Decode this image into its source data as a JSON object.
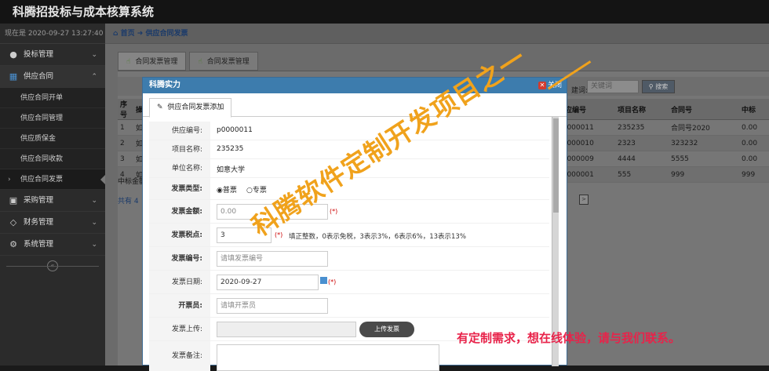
{
  "app": {
    "title": "科腾招投标与成本核算系统"
  },
  "sidebar": {
    "time_label": "现在是 2020-09-27 13:27:40",
    "groups": [
      {
        "icon": "user-icon",
        "label": "投标管理"
      },
      {
        "icon": "grid-icon",
        "label": "供应合同"
      },
      {
        "icon": "cart-icon",
        "label": "采购管理"
      },
      {
        "icon": "diamond-icon",
        "label": "财务管理"
      },
      {
        "icon": "gear-icon",
        "label": "系统管理"
      }
    ],
    "sub_items": [
      "供应合同开单",
      "供应合同管理",
      "供应质保金",
      "供应合同收款",
      "供应合同发票"
    ],
    "collapse_glyph": "«"
  },
  "breadcrumb": {
    "home": "首页",
    "current": "供应合同发票"
  },
  "tabs": [
    {
      "label": "合同发票管理"
    },
    {
      "label": "合同发票管理"
    }
  ],
  "toolbar": {
    "search_label": "建词:",
    "search_placeholder": "关键词",
    "search_button": "搜索"
  },
  "grid": {
    "columns": [
      "序号",
      "操",
      "供应编号",
      "项目名称",
      "合同号",
      "中标"
    ],
    "rows": [
      {
        "no": "1",
        "op": "如",
        "code": "p0000011",
        "project": "235235",
        "contract": "合同号2020",
        "bid": "0.00"
      },
      {
        "no": "2",
        "op": "如",
        "code": "p0000010",
        "project": "2323",
        "contract": "323232",
        "bid": "0.00"
      },
      {
        "no": "3",
        "op": "如",
        "code": "p0000009",
        "project": "4444",
        "contract": "5555",
        "bid": "0.00"
      },
      {
        "no": "4",
        "op": "如",
        "code": "p0000001",
        "project": "555",
        "contract": "999",
        "bid": "999"
      }
    ],
    "sum_label": "中标金额",
    "total_label": "共有 4",
    "next_glyph": ">"
  },
  "modal": {
    "title": "科腾实力",
    "close_label": "关闭",
    "tab_label": "供应合同发票添加",
    "fields": {
      "code_label": "供应编号:",
      "code_value": "p0000011",
      "project_label": "项目名称:",
      "project_value": "235235",
      "unit_label": "单位名称:",
      "unit_value": "如意大学",
      "type_label": "发票类型:",
      "type_opt1": "普票",
      "type_opt2": "专票",
      "amount_label": "发票金额:",
      "amount_value": "0.00",
      "tax_label": "发票税点:",
      "tax_value": "3",
      "tax_hint": "填正整数，0表示免税，3表示3%，6表示6%，13表示13%",
      "number_label": "发票编号:",
      "number_placeholder": "请填发票编号",
      "date_label": "发票日期:",
      "date_value": "2020-09-27",
      "issuer_label": "开票员:",
      "issuer_placeholder": "请填开票员",
      "upload_label": "发票上传:",
      "upload_button": "上传发票",
      "remark_label": "发票备注:",
      "required_mark": "(*)"
    }
  },
  "overlay": {
    "watermark": "科腾软件定制开发项目之一",
    "promo": "有定制需求，想在线体验，请与我们联系。"
  }
}
